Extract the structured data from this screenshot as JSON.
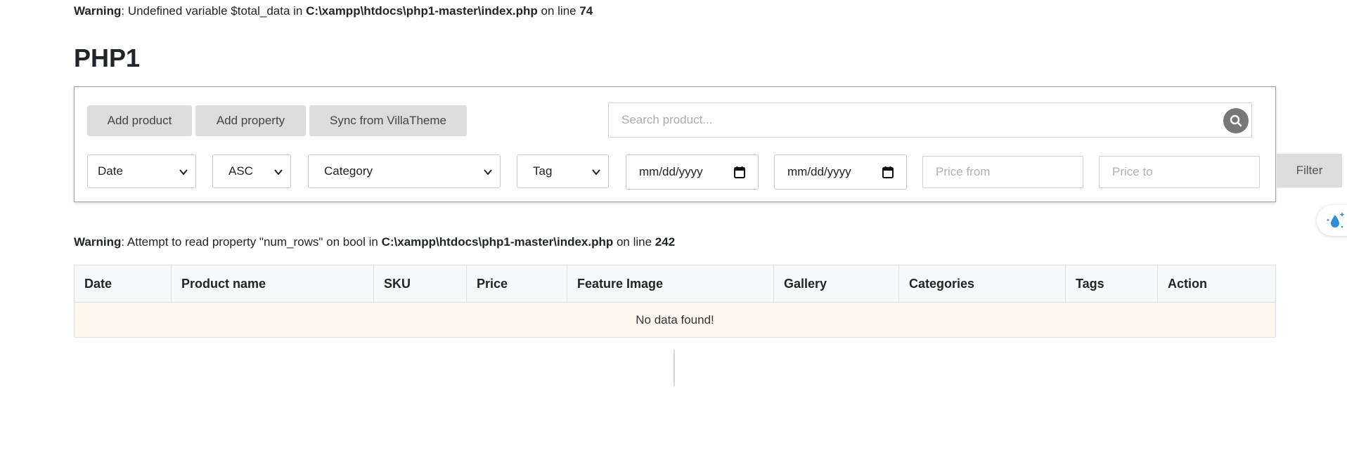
{
  "warnings": {
    "first": {
      "label": "Warning",
      "message": ": Undefined variable $total_data in ",
      "path": "C:\\xampp\\htdocs\\php1-master\\index.php",
      "on_line": " on line ",
      "line": "74"
    },
    "second": {
      "label": "Warning",
      "message": ": Attempt to read property \"num_rows\" on bool in ",
      "path": "C:\\xampp\\htdocs\\php1-master\\index.php",
      "on_line": " on line ",
      "line": "242"
    }
  },
  "page": {
    "title": "PHP1"
  },
  "toolbar": {
    "add_product": "Add product",
    "add_property": "Add property",
    "sync": "Sync from VillaTheme"
  },
  "search": {
    "placeholder": "Search product...",
    "icon": "search-icon"
  },
  "filters": {
    "sort_by": "Date",
    "order": "ASC",
    "category": "Category",
    "tag": "Tag",
    "date_from": "mm/dd/yyyy",
    "date_to": "mm/dd/yyyy",
    "price_from_placeholder": "Price from",
    "price_to_placeholder": "Price to",
    "filter_button": "Filter"
  },
  "table": {
    "columns": [
      "Date",
      "Product name",
      "SKU",
      "Price",
      "Feature Image",
      "Gallery",
      "Categories",
      "Tags",
      "Action"
    ],
    "empty_message": "No data found!"
  },
  "colors": {
    "button_bg": "#dcdcdc",
    "header_bg": "#f8f9fa",
    "empty_row_bg": "#fff8ef",
    "widget_accent": "#2a8fd8"
  }
}
